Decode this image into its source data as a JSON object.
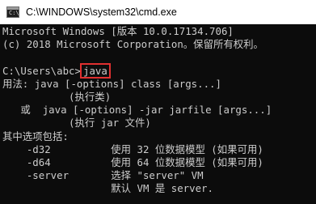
{
  "window": {
    "title": "C:\\WINDOWS\\system32\\cmd.exe",
    "icon": "cmd-icon",
    "icon_prompt": "C:\\"
  },
  "colors": {
    "console_bg": "#0c0c0c",
    "console_fg": "#cccccc",
    "highlight": "#e03030"
  },
  "console": {
    "header1": "Microsoft Windows [版本 10.0.17134.706]",
    "header2": "(c) 2018 Microsoft Corporation。保留所有权利。",
    "blank": "",
    "prompt": "C:\\Users\\abc>",
    "command": "java",
    "usage1": "用法: java [-options] class [args...]",
    "usage2": "           (执行类)",
    "usage3": "   或  java [-options] -jar jarfile [args...]",
    "usage4": "           (执行 jar 文件)",
    "options_header": "其中选项包括:",
    "opt_d32": "    -d32          使用 32 位数据模型 (如果可用)",
    "opt_d64": "    -d64          使用 64 位数据模型 (如果可用)",
    "opt_server": "    -server       选择 \"server\" VM",
    "opt_default": "                  默认 VM 是 server."
  }
}
